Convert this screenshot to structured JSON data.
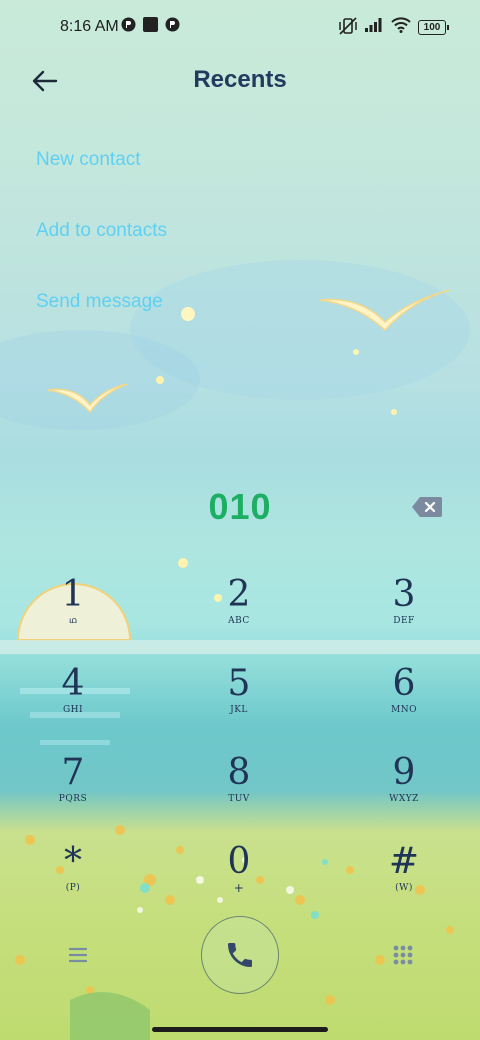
{
  "status_bar": {
    "time": "8:16 AM",
    "battery": "100",
    "icons": [
      "notification-icon",
      "square-icon",
      "notification-icon",
      "vibrate-mute-icon",
      "signal-icon",
      "wifi-icon",
      "battery-icon"
    ]
  },
  "header": {
    "title": "Recents",
    "back_icon": "arrow-left-icon"
  },
  "menu": {
    "new_contact": "New contact",
    "add_to_contacts": "Add to contacts",
    "send_message": "Send message"
  },
  "dialer": {
    "number": "010",
    "backspace_icon": "backspace-icon",
    "keys": [
      {
        "digit": "1",
        "letters": "ഥ"
      },
      {
        "digit": "2",
        "letters": "ABC"
      },
      {
        "digit": "3",
        "letters": "DEF"
      },
      {
        "digit": "4",
        "letters": "GHI"
      },
      {
        "digit": "5",
        "letters": "JKL"
      },
      {
        "digit": "6",
        "letters": "MNO"
      },
      {
        "digit": "7",
        "letters": "PQRS"
      },
      {
        "digit": "8",
        "letters": "TUV"
      },
      {
        "digit": "9",
        "letters": "WXYZ"
      },
      {
        "digit": "*",
        "letters": "(P)"
      },
      {
        "digit": "0",
        "letters": "+"
      },
      {
        "digit": "#",
        "letters": "(W)"
      }
    ]
  },
  "bottom_bar": {
    "menu_icon": "hamburger-icon",
    "call_icon": "phone-icon",
    "dialpad_icon": "dialpad-grid-icon"
  },
  "colors": {
    "title": "#233a5e",
    "link": "#5fd0f2",
    "number": "#1cae63",
    "digits": "#203456"
  }
}
